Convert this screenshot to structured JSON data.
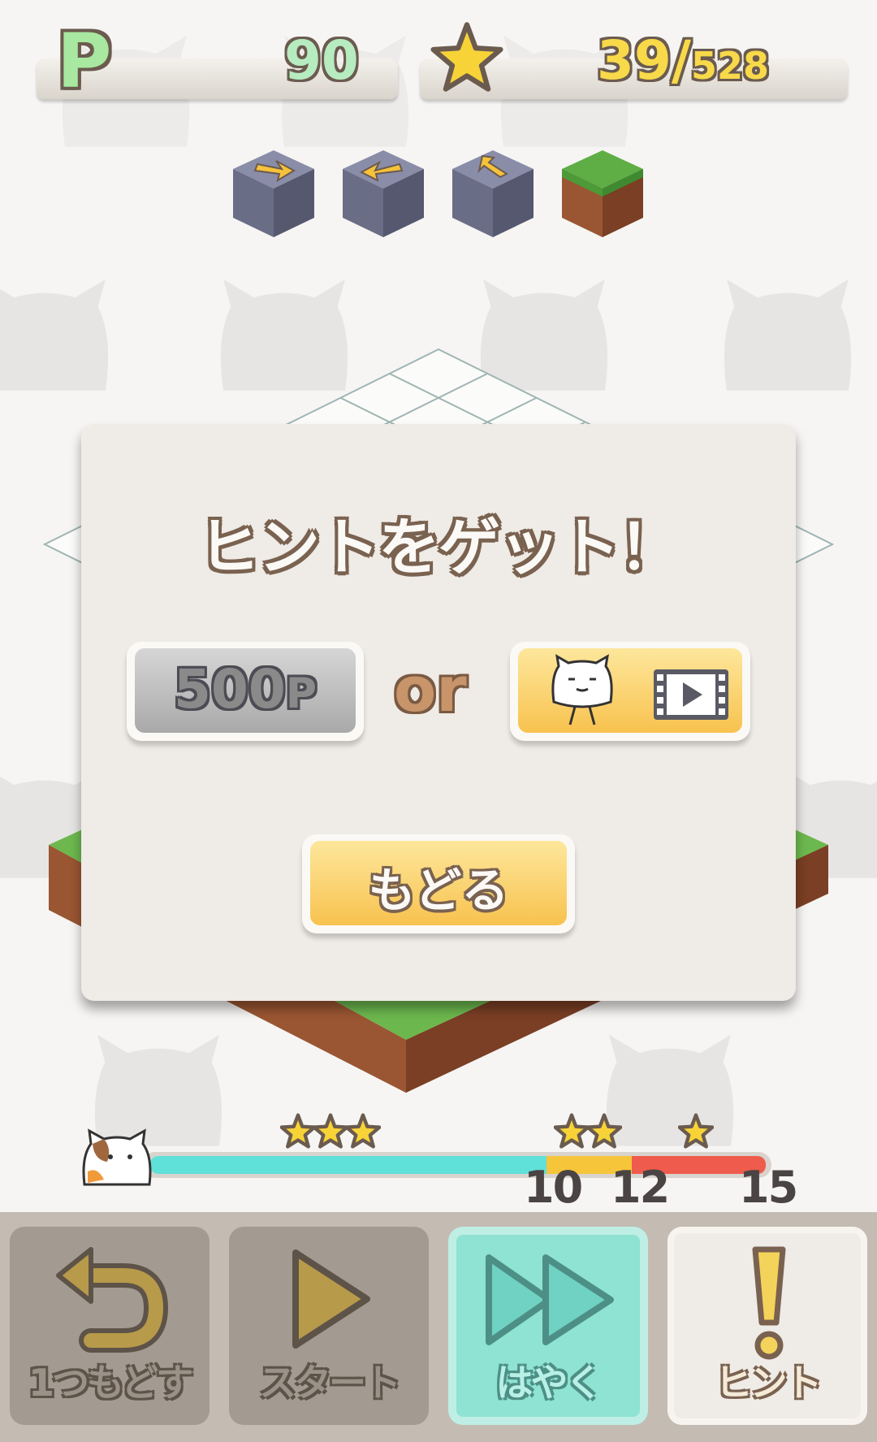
{
  "status": {
    "points_icon": "P",
    "points": "90",
    "star_icon": "star-icon",
    "stars_collected": "39",
    "stars_separator": "/",
    "stars_total": "528"
  },
  "command_queue": [
    "arrow-block-right",
    "arrow-block-left",
    "arrow-block-up",
    "grass-block"
  ],
  "dialog": {
    "title": "ヒントをゲット！",
    "points_button_value": "500",
    "points_button_unit": "P",
    "or_label": "or",
    "video_button_icons": [
      "cat-icon",
      "video-icon"
    ],
    "back_button_label": "もどる"
  },
  "progress": {
    "icon": "calico-cat-icon",
    "tick_labels": [
      "10",
      "12",
      "15"
    ],
    "star_rewards": [
      3,
      2,
      1
    ],
    "colors": {
      "cyan": "#5fe0d8",
      "yellow": "#f7c53a",
      "red": "#ef5b4c"
    }
  },
  "controls": {
    "undo_label": "1つもどす",
    "start_label": "スタート",
    "fast_label": "はやく",
    "hint_label": "ヒント"
  },
  "colors": {
    "accent_yellow": "#f8c24e",
    "accent_green": "#a8e8a0",
    "fast_active": "#8ee3d2"
  }
}
